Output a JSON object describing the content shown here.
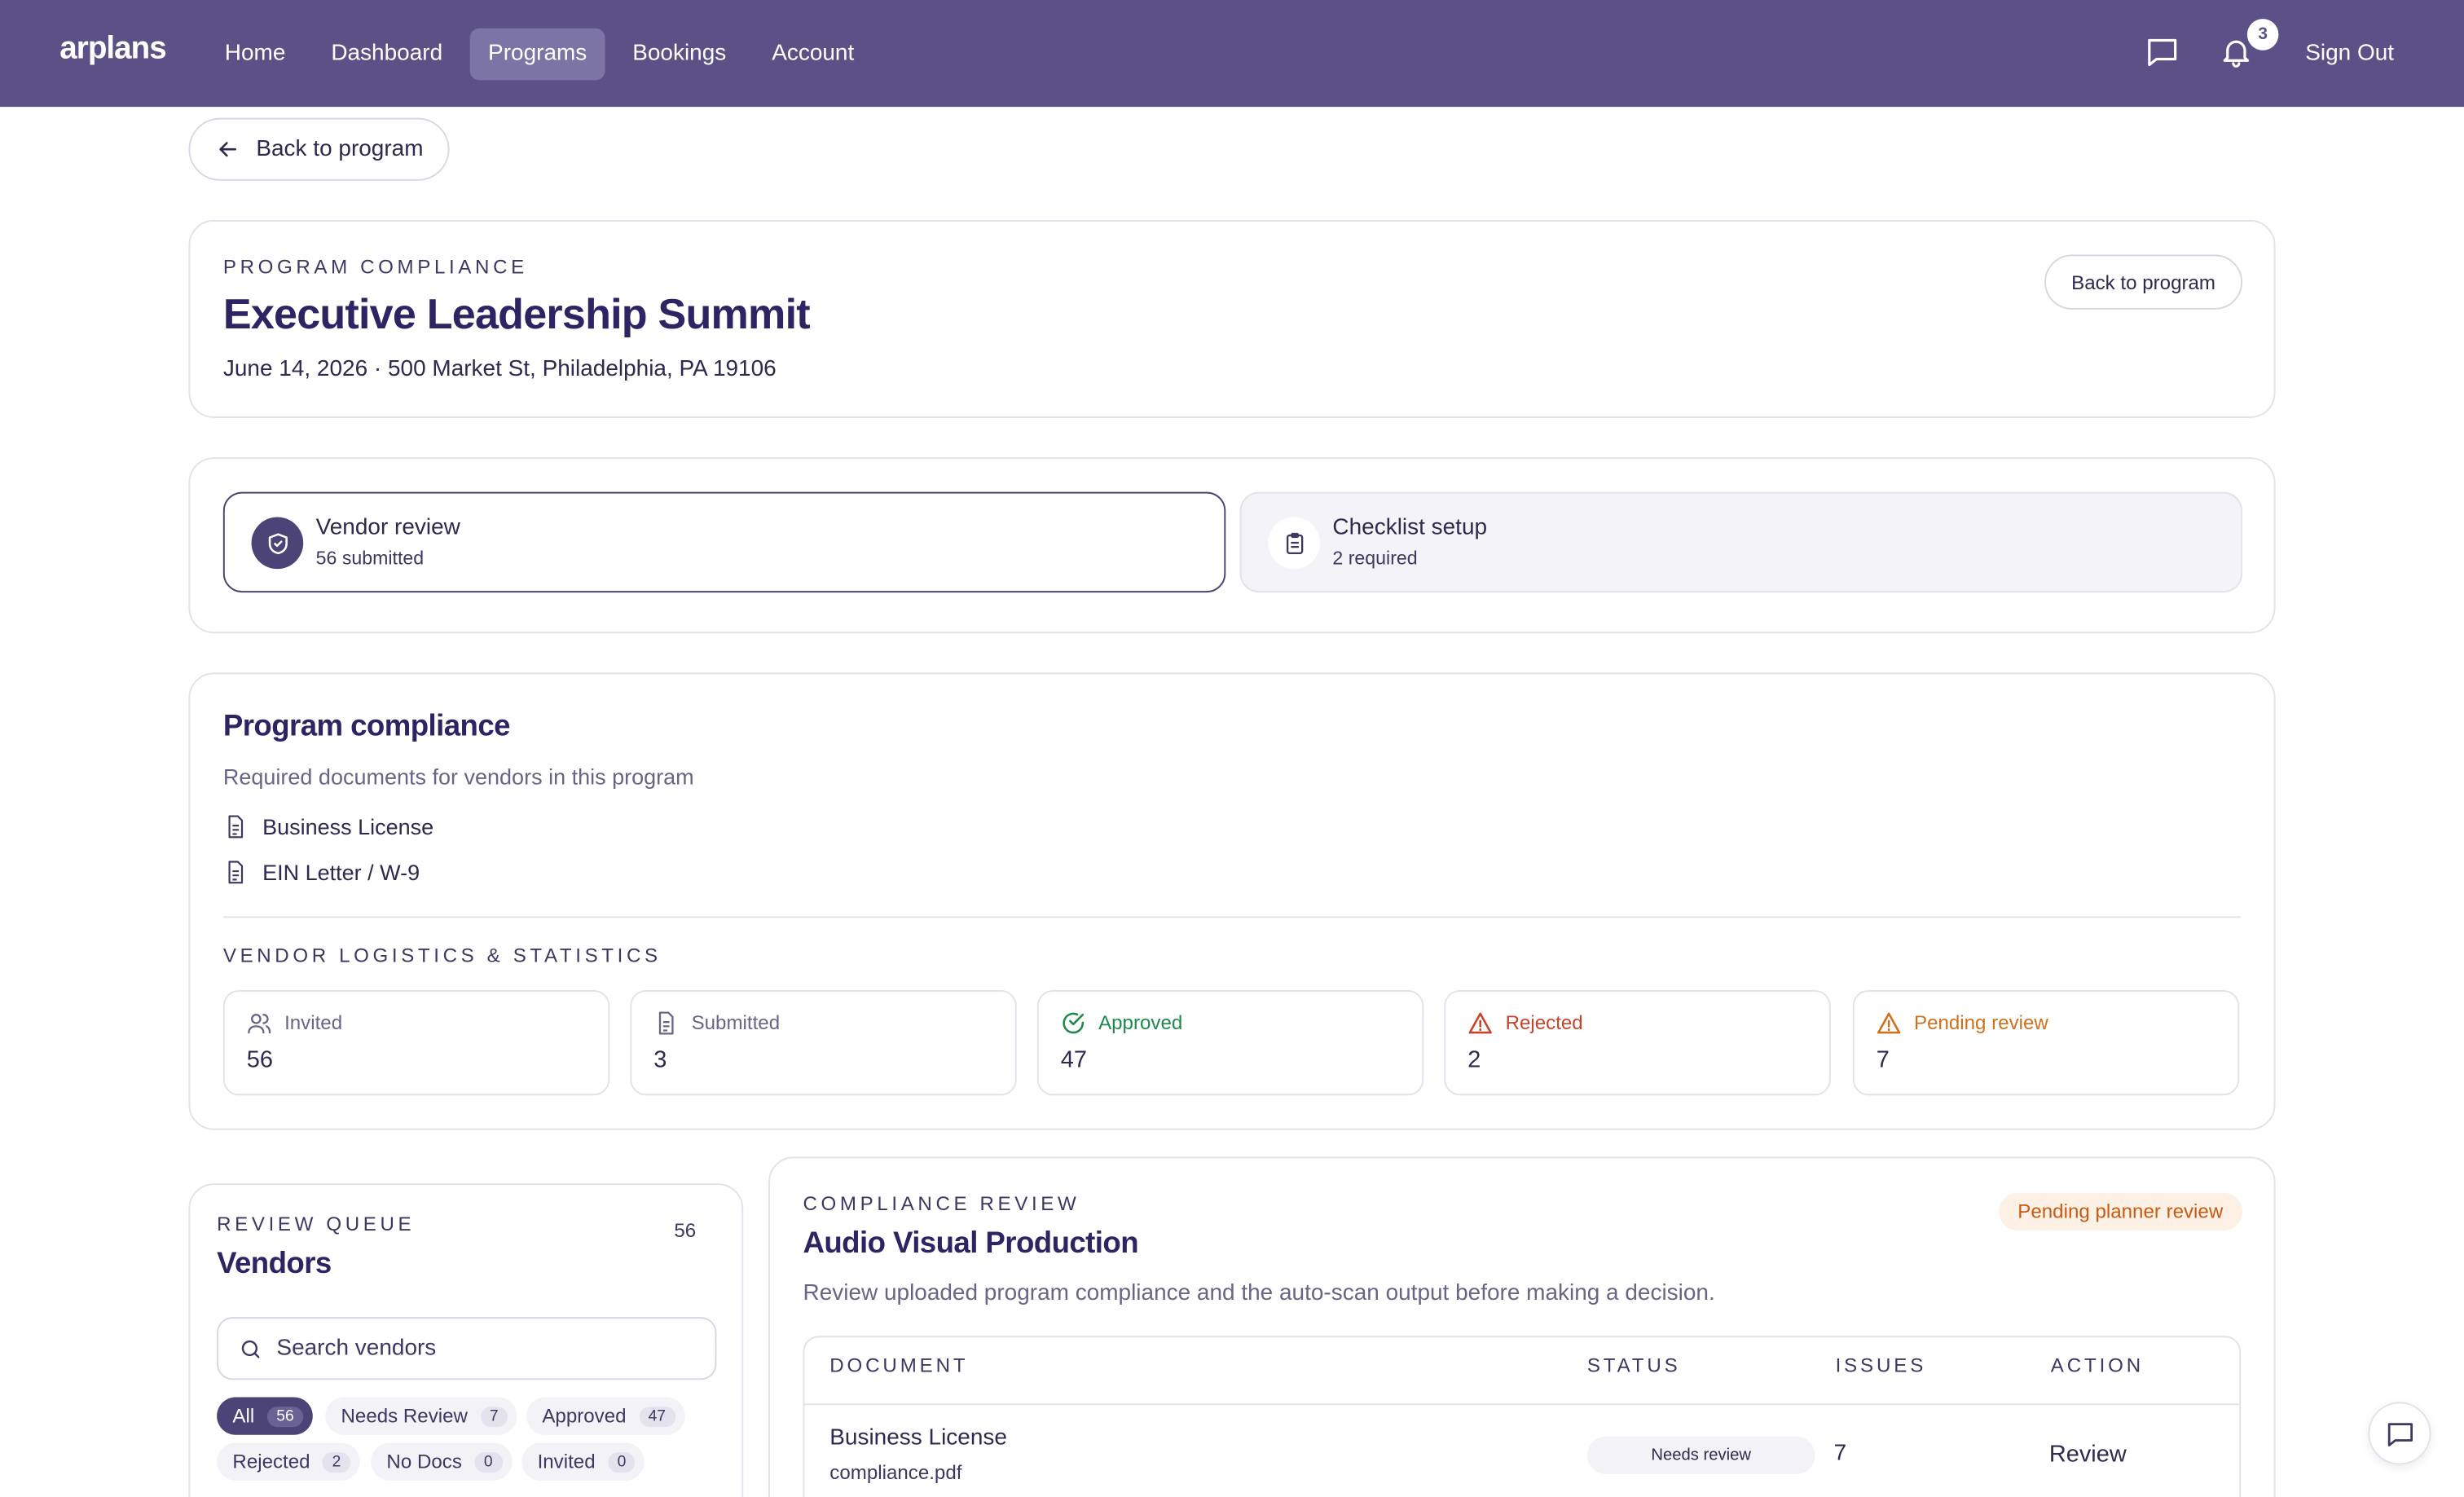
{
  "nav": {
    "logo": "arplans",
    "links": [
      "Home",
      "Dashboard",
      "Programs",
      "Bookings",
      "Account"
    ],
    "active_link": "Programs",
    "notification_count": "3",
    "sign_out": "Sign Out"
  },
  "back_button": "Back to program",
  "header": {
    "eyebrow": "PROGRAM COMPLIANCE",
    "title": "Executive Leadership Summit",
    "subtitle": "June 14, 2026 · 500 Market St, Philadelphia, PA 19106",
    "back_button": "Back to program"
  },
  "steps": [
    {
      "title": "Vendor review",
      "sub": "56 submitted"
    },
    {
      "title": "Checklist setup",
      "sub": "2 required"
    }
  ],
  "compliance": {
    "title": "Program compliance",
    "description": "Required documents for vendors in this program",
    "documents": [
      "Business License",
      "EIN Letter / W-9"
    ],
    "stats_heading": "VENDOR LOGISTICS & STATISTICS",
    "stats": [
      {
        "label": "Invited",
        "value": "56",
        "color": "#6a6587"
      },
      {
        "label": "Submitted",
        "value": "3",
        "color": "#6a6587"
      },
      {
        "label": "Approved",
        "value": "47",
        "color": "#1f8a4c"
      },
      {
        "label": "Rejected",
        "value": "2",
        "color": "#c9432b"
      },
      {
        "label": "Pending review",
        "value": "7",
        "color": "#d0701a"
      }
    ]
  },
  "queue": {
    "eyebrow": "REVIEW QUEUE",
    "title": "Vendors",
    "count": "56",
    "search_placeholder": "Search vendors",
    "filters": [
      {
        "label": "All",
        "count": "56"
      },
      {
        "label": "Needs Review",
        "count": "7"
      },
      {
        "label": "Approved",
        "count": "47"
      },
      {
        "label": "Rejected",
        "count": "2"
      },
      {
        "label": "No Docs",
        "count": "0"
      },
      {
        "label": "Invited",
        "count": "0"
      }
    ]
  },
  "review": {
    "eyebrow": "COMPLIANCE REVIEW",
    "title": "Audio Visual Production",
    "badge": "Pending planner review",
    "description": "Review uploaded program compliance and the auto-scan output before making a decision.",
    "columns": [
      "DOCUMENT",
      "STATUS",
      "ISSUES",
      "ACTION"
    ],
    "rows": [
      {
        "document": "Business License",
        "file": "compliance.pdf",
        "status": "Needs review",
        "issues": "7",
        "action": "Review"
      }
    ]
  }
}
